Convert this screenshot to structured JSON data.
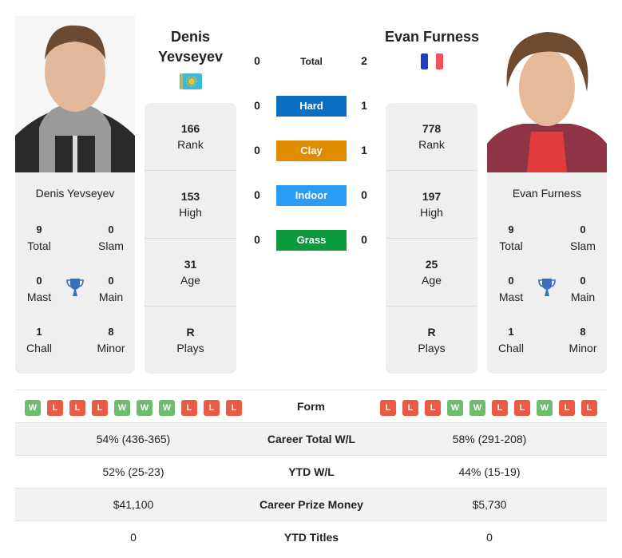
{
  "player1": {
    "name_line1": "Denis",
    "name_line2": "Yevseyev",
    "full_name": "Denis Yevseyev",
    "country": "Kazakhstan",
    "flag_icon": "kazakhstan-flag-icon",
    "rank": "166",
    "rank_label": "Rank",
    "high": "153",
    "high_label": "High",
    "age": "31",
    "age_label": "Age",
    "plays": "R",
    "plays_label": "Plays",
    "titles": {
      "total": "9",
      "total_label": "Total",
      "slam": "0",
      "slam_label": "Slam",
      "mast": "0",
      "mast_label": "Mast",
      "main": "0",
      "main_label": "Main",
      "chall": "1",
      "chall_label": "Chall",
      "minor": "8",
      "minor_label": "Minor"
    },
    "form": [
      "W",
      "L",
      "L",
      "L",
      "W",
      "W",
      "W",
      "L",
      "L",
      "L"
    ]
  },
  "player2": {
    "name": "Evan Furness",
    "full_name": "Evan Furness",
    "country": "France",
    "flag_icon": "france-flag-icon",
    "rank": "778",
    "rank_label": "Rank",
    "high": "197",
    "high_label": "High",
    "age": "25",
    "age_label": "Age",
    "plays": "R",
    "plays_label": "Plays",
    "titles": {
      "total": "9",
      "total_label": "Total",
      "slam": "0",
      "slam_label": "Slam",
      "mast": "0",
      "mast_label": "Mast",
      "main": "0",
      "main_label": "Main",
      "chall": "1",
      "chall_label": "Chall",
      "minor": "8",
      "minor_label": "Minor"
    },
    "form": [
      "L",
      "L",
      "L",
      "W",
      "W",
      "L",
      "L",
      "W",
      "L",
      "L"
    ]
  },
  "h2h": [
    {
      "label": "Total",
      "p1": "0",
      "p2": "2",
      "color": ""
    },
    {
      "label": "Hard",
      "p1": "0",
      "p2": "1",
      "color": "#0a6fc2"
    },
    {
      "label": "Clay",
      "p1": "0",
      "p2": "1",
      "color": "#e08b00"
    },
    {
      "label": "Indoor",
      "p1": "0",
      "p2": "0",
      "color": "#2b9bf4"
    },
    {
      "label": "Grass",
      "p1": "0",
      "p2": "0",
      "color": "#0b9a3c"
    }
  ],
  "form_label": "Form",
  "colors": {
    "win": "#6cbd6e",
    "loss": "#ea5b44",
    "trophy": "#3a6fbf"
  },
  "comparison": [
    {
      "label": "Career Total W/L",
      "p1": "54% (436-365)",
      "p2": "58% (291-208)"
    },
    {
      "label": "YTD W/L",
      "p1": "52% (25-23)",
      "p2": "44% (15-19)"
    },
    {
      "label": "Career Prize Money",
      "p1": "$41,100",
      "p2": "$5,730"
    },
    {
      "label": "YTD Titles",
      "p1": "0",
      "p2": "0"
    }
  ]
}
